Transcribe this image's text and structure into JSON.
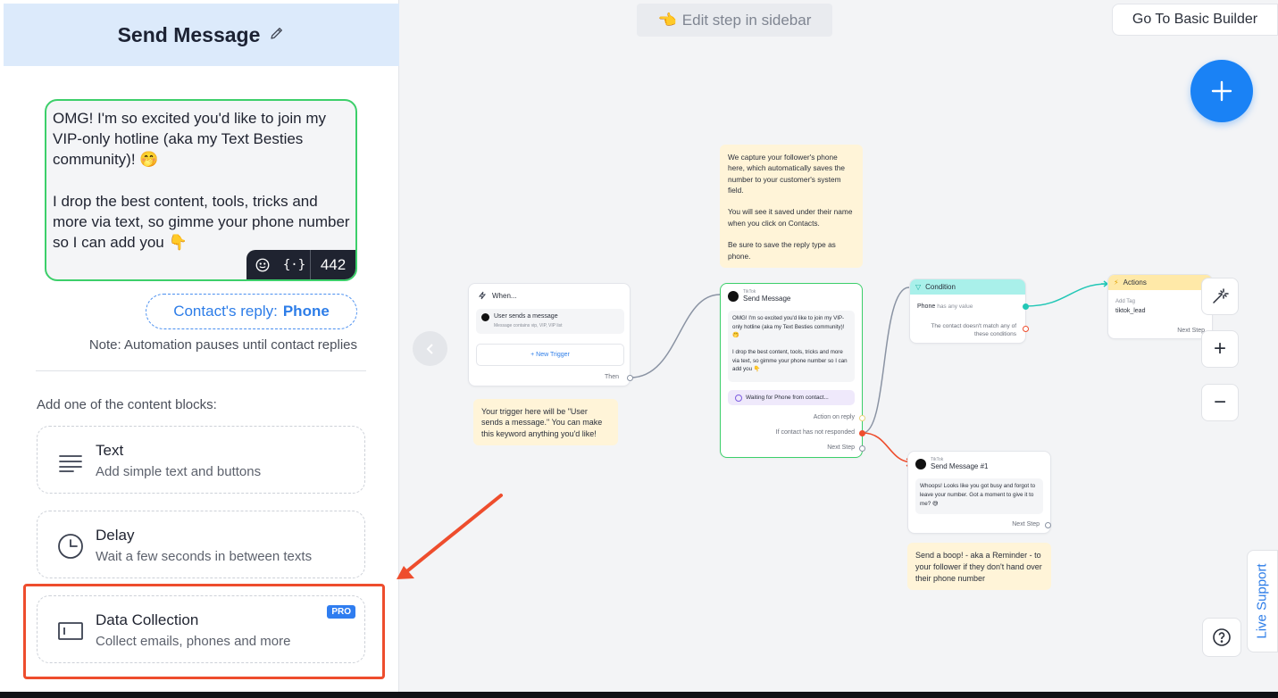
{
  "sidebar": {
    "title": "Send Message",
    "message": "OMG! I'm so excited you'd like to join my VIP-only hotline (aka my Text Besties community)! 🤭\n\nI drop the best content, tools, tricks and more via text, so gimme your phone number so I can add you 👇",
    "toolbar": {
      "vars_label": "{·}",
      "char_count": "442"
    },
    "reply": {
      "prefix": "Contact's reply:",
      "type": "Phone"
    },
    "note": "Note: Automation pauses until contact replies",
    "add_blocks_label": "Add one of the content blocks:",
    "blocks": [
      {
        "title": "Text",
        "desc": "Add simple text and buttons"
      },
      {
        "title": "Delay",
        "desc": "Wait a few seconds in between texts"
      },
      {
        "title": "Data Collection",
        "desc": "Collect emails, phones and more",
        "badge": "PRO"
      }
    ]
  },
  "topbar": {
    "edit_hint": "Edit step in sidebar",
    "edit_hint_emoji": "👈",
    "basic_builder": "Go To Basic Builder"
  },
  "canvas": {
    "trigger_node": {
      "header": "When...",
      "trigger_title": "User sends a message",
      "trigger_sub": "Message contains vip, VIP, VIP list",
      "new_trigger": "+ New Trigger",
      "then": "Then"
    },
    "trigger_note": "Your trigger here will be \"User sends a message.\" You can make this keyword anything you'd like!",
    "phone_note": "We capture your follower's phone here, which automatically saves the number to your customer's system field.\n\nYou will see it saved under their name when you click on Contacts.\n\nBe sure to save the reply type as phone.",
    "send_node": {
      "platform": "TikTok",
      "title": "Send Message",
      "message": "OMG! I'm so excited you'd like to join my VIP-only hotline (aka my Text Besties community)! 🤭\n\nI drop the best content, tools, tricks and more via text, so gimme your phone number so I can add you 👇",
      "waiting": "Waiting for Phone from contact...",
      "action_on_reply": "Action on reply",
      "not_responded": "If contact has not responded",
      "next_step": "Next Step"
    },
    "condition_node": {
      "title": "Condition",
      "field": "Phone",
      "rule": "has any value",
      "else": "The contact doesn't match any of these conditions"
    },
    "actions_node": {
      "title": "Actions",
      "label": "Add Tag",
      "value": "tiktok_lead",
      "next_step": "Next Step"
    },
    "send2_node": {
      "platform": "TikTok",
      "title": "Send Message #1",
      "message": "Whoops! Looks like you got busy and forgot to leave your number. Got a moment to give it to me? 😅",
      "next_step": "Next Step"
    },
    "reminder_note": "Send a boop! - aka a Reminder - to your follower if they don't hand over their phone number"
  },
  "controls": {
    "zoom_in": "+",
    "zoom_out": "−",
    "live_support": "Live Support"
  },
  "colors": {
    "accent_blue": "#1a82f5",
    "success_green": "#3ccf6a",
    "highlight_red": "#ee4d2d",
    "sticky_yellow": "#fff4d8",
    "condition_teal": "#a9f0ea",
    "actions_yellow": "#ffe9a8"
  }
}
